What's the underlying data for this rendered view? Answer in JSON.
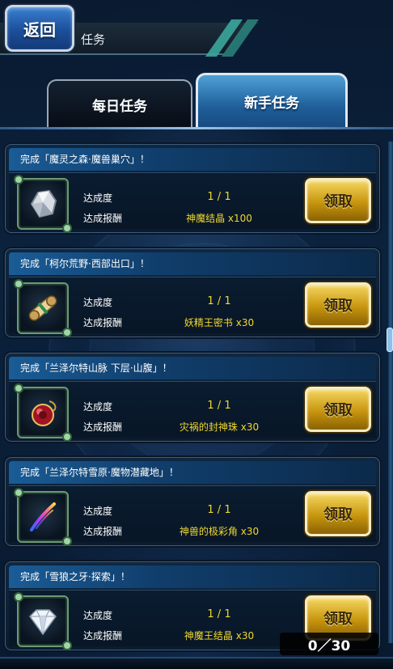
{
  "header": {
    "back_label": "返回",
    "title": "任务"
  },
  "tabs": [
    {
      "label": "每日任务",
      "active": false
    },
    {
      "label": "新手任务",
      "active": true
    }
  ],
  "labels": {
    "progress": "达成度",
    "reward": "达成报酬",
    "claim": "领取"
  },
  "tasks": [
    {
      "title": "完成「魔灵之森·魔兽巢穴」！",
      "progress": "1 / 1",
      "reward": "神魔结晶 x100",
      "icon": "crystal-ore-icon"
    },
    {
      "title": "完成「柯尔荒野·西部出口」！",
      "progress": "1 / 1",
      "reward": "妖精王密书 x30",
      "icon": "scroll-icon"
    },
    {
      "title": "完成「兰泽尔特山脉 下层·山腹」！",
      "progress": "1 / 1",
      "reward": "灾祸的封神珠 x30",
      "icon": "red-orb-icon"
    },
    {
      "title": "完成「兰泽尔特雪原·魔物潜藏地」！",
      "progress": "1 / 1",
      "reward": "神兽的极彩角 x30",
      "icon": "rainbow-horn-icon"
    },
    {
      "title": "完成「雪狼之牙·探索」！",
      "progress": "1 / 1",
      "reward": "神魔王结晶 x30",
      "icon": "diamond-icon"
    }
  ],
  "counter": "0／30",
  "colors": {
    "accent_blue": "#1f5f9a",
    "claim_gold": "#c8950e",
    "value_yellow": "#f0d830"
  }
}
